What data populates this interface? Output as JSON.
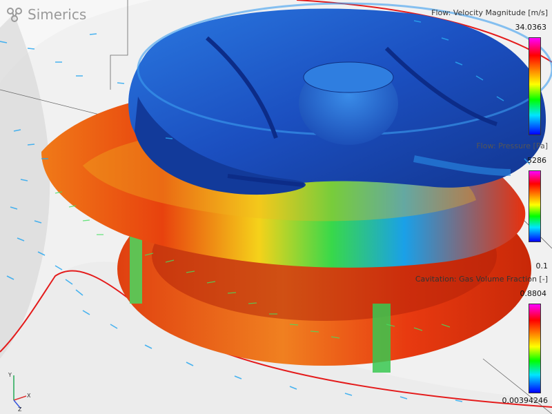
{
  "brand": {
    "name": "Simerics"
  },
  "legends": [
    {
      "title": "Flow: Velocity Magnitude [m/s]",
      "max": "34.0363",
      "min": ""
    },
    {
      "title": "Flow: Pressure [Pa]",
      "max": "5286",
      "min": "0.1"
    },
    {
      "title": "Cavitation: Gas Volume Fraction [-]",
      "max": "0.8804",
      "min": "0.00394246"
    }
  ],
  "axes": {
    "x": "X",
    "y": "Y",
    "z": "Z"
  },
  "colors": {
    "accent_red": "#e41b1b",
    "velocity_low": "#1e50c8",
    "velocity_high": "#e8300c"
  }
}
